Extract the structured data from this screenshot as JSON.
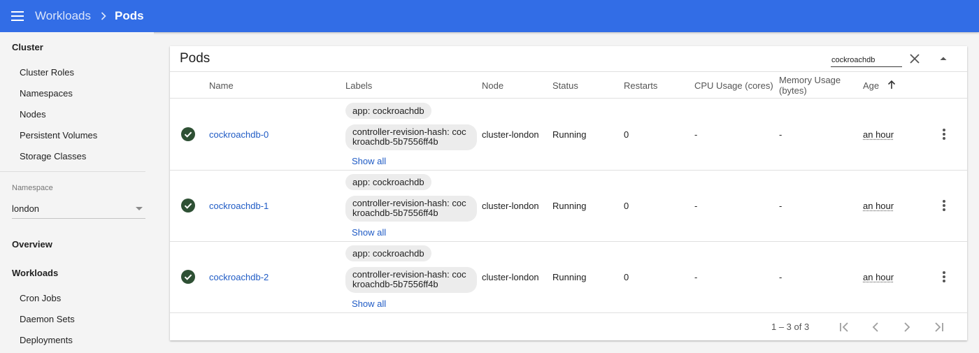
{
  "header": {
    "breadcrumb_parent": "Workloads",
    "breadcrumb_current": "Pods"
  },
  "sidebar": {
    "cluster_heading": "Cluster",
    "cluster_items": [
      "Cluster Roles",
      "Namespaces",
      "Nodes",
      "Persistent Volumes",
      "Storage Classes"
    ],
    "namespace_label": "Namespace",
    "namespace_value": "london",
    "overview": "Overview",
    "workloads_heading": "Workloads",
    "workload_items": [
      "Cron Jobs",
      "Daemon Sets",
      "Deployments"
    ]
  },
  "card": {
    "title": "Pods",
    "filter_value": "cockroachdb",
    "columns": {
      "name": "Name",
      "labels": "Labels",
      "node": "Node",
      "status": "Status",
      "restarts": "Restarts",
      "cpu": "CPU Usage (cores)",
      "memory_line1": "Memory Usage",
      "memory_line2": "(bytes)",
      "age": "Age"
    },
    "rows": [
      {
        "name": "cockroachdb-0",
        "label_app": "app: cockroachdb",
        "label_hash_line1": "controller-revision-hash: coc",
        "label_hash_line2": "kroachdb-5b7556ff4b",
        "show_all": "Show all",
        "node": "cluster-london",
        "status": "Running",
        "restarts": "0",
        "cpu": "-",
        "memory": "-",
        "age": "an hour"
      },
      {
        "name": "cockroachdb-1",
        "label_app": "app: cockroachdb",
        "label_hash_line1": "controller-revision-hash: coc",
        "label_hash_line2": "kroachdb-5b7556ff4b",
        "show_all": "Show all",
        "node": "cluster-london",
        "status": "Running",
        "restarts": "0",
        "cpu": "-",
        "memory": "-",
        "age": "an hour"
      },
      {
        "name": "cockroachdb-2",
        "label_app": "app: cockroachdb",
        "label_hash_line1": "controller-revision-hash: coc",
        "label_hash_line2": "kroachdb-5b7556ff4b",
        "show_all": "Show all",
        "node": "cluster-london",
        "status": "Running",
        "restarts": "0",
        "cpu": "-",
        "memory": "-",
        "age": "an hour"
      }
    ],
    "pagination": {
      "range": "1 – 3 of 3"
    }
  },
  "icons": {
    "menu": "menu-icon",
    "breadcrumb_separator": "chevron-right-icon",
    "clear_filter": "close-icon",
    "collapse": "caret-up-icon",
    "sort": "arrow-up-icon",
    "status_ok": "check-circle-icon",
    "more": "more-vert-icon",
    "first_page": "first-page-icon",
    "prev_page": "chevron-left-icon",
    "next_page": "chevron-right-icon",
    "last_page": "last-page-icon"
  },
  "colors": {
    "topbar": "#326de6",
    "link": "#1f5bc5",
    "status_ok": "#2e5034"
  }
}
